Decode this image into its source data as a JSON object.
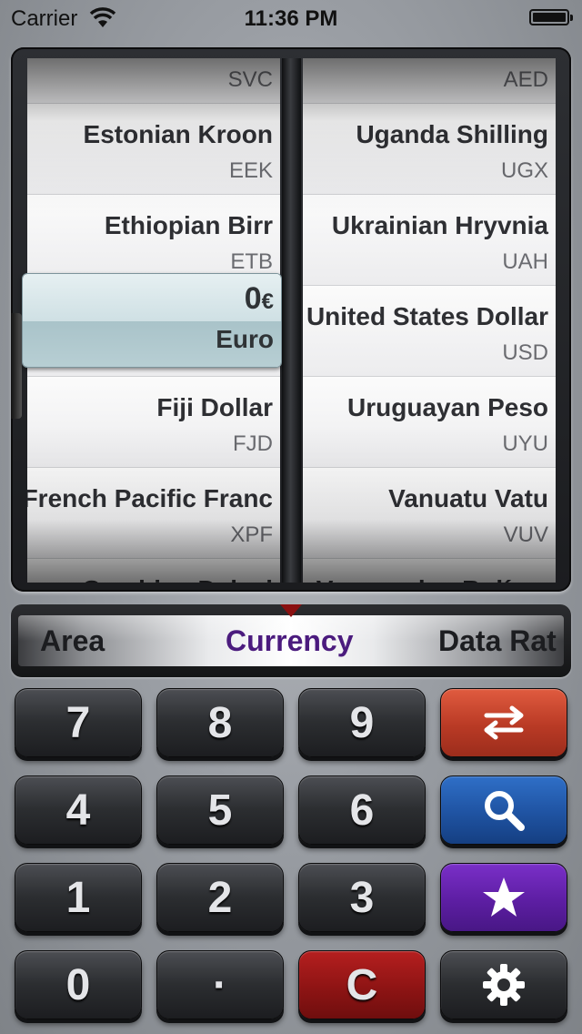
{
  "status_bar": {
    "carrier": "Carrier",
    "time": "11:36 PM"
  },
  "left_wheel": {
    "top_partial_code": "SVC",
    "rows": [
      {
        "name": "Estonian Kroon",
        "code": "EEK"
      },
      {
        "name": "Ethiopian Birr",
        "code": "ETB"
      },
      {
        "name": "Fiji Dollar",
        "code": "FJD"
      },
      {
        "name": "French Pacific Franc",
        "code": "XPF"
      }
    ],
    "bottom_partial_name": "Gambian Dalasi",
    "selected": {
      "amount": "0",
      "currency_symbol": "€",
      "unit": "Euro"
    }
  },
  "right_wheel": {
    "top_partial_code": "AED",
    "rows": [
      {
        "name": "Uganda Shilling",
        "code": "UGX"
      },
      {
        "name": "Ukrainian Hryvnia",
        "code": "UAH"
      },
      {
        "name": "United States Dollar",
        "code": "USD"
      },
      {
        "name": "Uruguayan Peso",
        "code": "UYU"
      },
      {
        "name": "Vanuatu Vatu",
        "code": "VUV"
      }
    ],
    "bottom_partial_name": "Venezuelan Bolívar"
  },
  "categories": {
    "left": "Area",
    "active": "Currency",
    "right": "Data Rat"
  },
  "keypad": {
    "keys": [
      "7",
      "8",
      "9",
      "4",
      "5",
      "6",
      "1",
      "2",
      "3",
      "0",
      "·",
      "C"
    ],
    "swap_icon": "swap-arrows-icon",
    "search_icon": "search-icon",
    "favorite_icon": "star-icon",
    "settings_icon": "gear-icon"
  },
  "colors": {
    "swap_key": "#b93a25",
    "search_key": "#1f53a2",
    "favorite_key": "#5d1ea3",
    "clear_key": "#8e1414",
    "active_category": "#4b1b7e",
    "selection_highlight": "#a9c3c9"
  }
}
